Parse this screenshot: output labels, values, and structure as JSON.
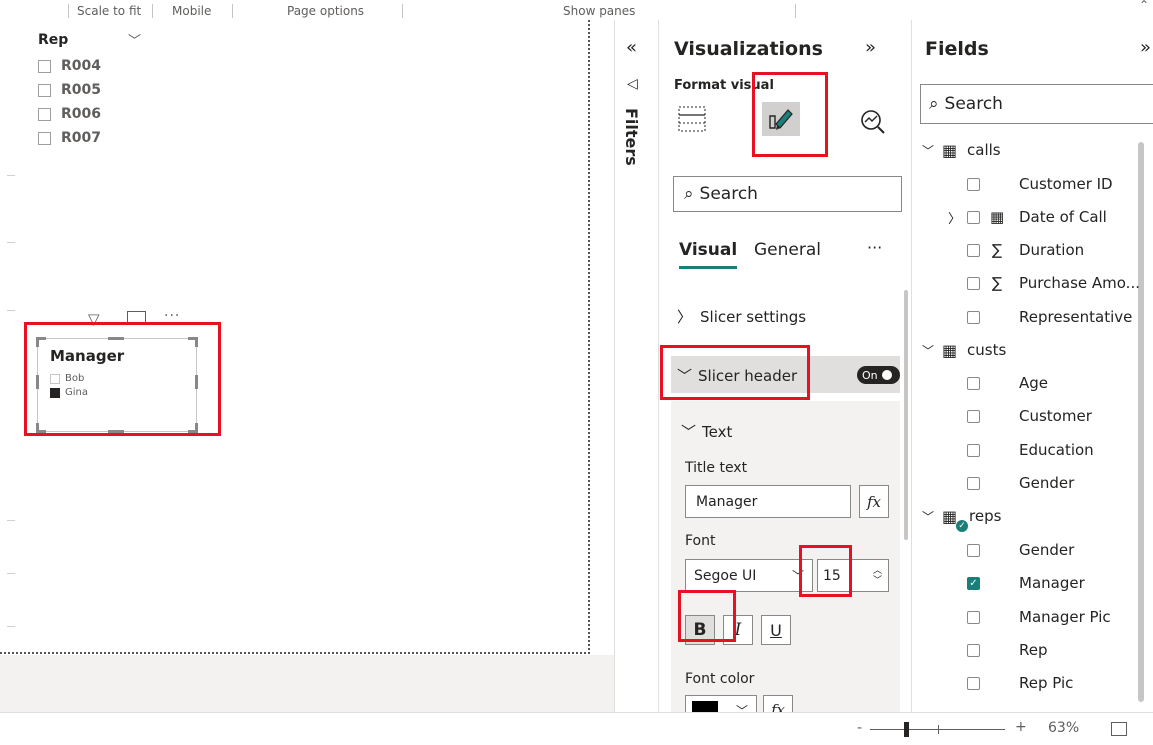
{
  "ribbon": {
    "scale_to_fit": "Scale to fit",
    "mobile": "Mobile",
    "page_options": "Page options",
    "show_panes": "Show panes"
  },
  "canvas": {
    "rep_slicer": {
      "title": "Rep",
      "items": [
        "R004",
        "R005",
        "R006",
        "R007"
      ]
    },
    "manager_slicer": {
      "title": "Manager",
      "items": [
        {
          "label": "Bob",
          "checked": false
        },
        {
          "label": "Gina",
          "checked": true
        }
      ]
    }
  },
  "filters": {
    "label": "Filters"
  },
  "visualizations": {
    "title": "Visualizations",
    "subtitle": "Format visual",
    "search_placeholder": "Search",
    "tabs": {
      "visual": "Visual",
      "general": "General",
      "more": "···"
    },
    "sections": {
      "slicer_settings": "Slicer settings",
      "slicer_header": "Slicer header",
      "toggle": "On",
      "text": "Text",
      "title_text_label": "Title text",
      "title_text_value": "Manager",
      "font_label": "Font",
      "font_family": "Segoe UI",
      "font_size": "15",
      "bold": "B",
      "italic": "I",
      "underline": "U",
      "font_color_label": "Font color",
      "fx": "fx",
      "font_color": "#000000"
    }
  },
  "fields": {
    "title": "Fields",
    "search_placeholder": "Search",
    "tables": [
      {
        "name": "calls",
        "items": [
          {
            "label": "Customer ID",
            "type": "plain",
            "checked": false
          },
          {
            "label": "Date of Call",
            "type": "date",
            "checked": false
          },
          {
            "label": "Duration",
            "type": "sum",
            "checked": false
          },
          {
            "label": "Purchase Amo...",
            "type": "sum",
            "checked": false
          },
          {
            "label": "Representative",
            "type": "plain",
            "checked": false
          }
        ]
      },
      {
        "name": "custs",
        "items": [
          {
            "label": "Age",
            "type": "plain",
            "checked": false
          },
          {
            "label": "Customer",
            "type": "plain",
            "checked": false
          },
          {
            "label": "Education",
            "type": "plain",
            "checked": false
          },
          {
            "label": "Gender",
            "type": "plain",
            "checked": false
          }
        ]
      },
      {
        "name": "reps",
        "items": [
          {
            "label": "Gender",
            "type": "plain",
            "checked": false
          },
          {
            "label": "Manager",
            "type": "plain",
            "checked": true
          },
          {
            "label": "Manager Pic",
            "type": "plain",
            "checked": false
          },
          {
            "label": "Rep",
            "type": "plain",
            "checked": false
          },
          {
            "label": "Rep Pic",
            "type": "plain",
            "checked": false
          }
        ]
      }
    ]
  },
  "status": {
    "zoom_minus": "-",
    "zoom_plus": "+",
    "zoom": "63%"
  },
  "colors": {
    "accent": "#1b7f79",
    "highlight": "#e81123"
  }
}
